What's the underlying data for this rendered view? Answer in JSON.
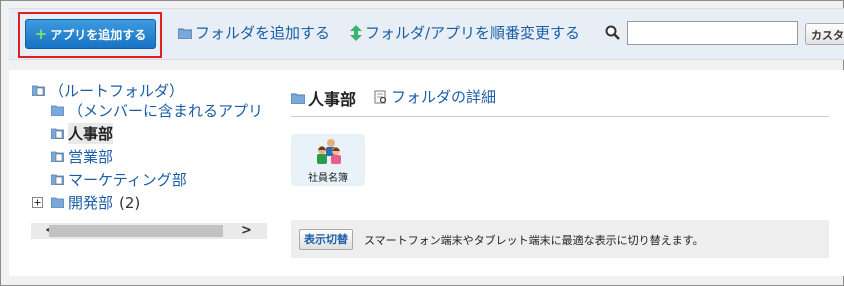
{
  "toolbar": {
    "add_app_label": "アプリを追加する",
    "add_folder_label": "フォルダを追加する",
    "reorder_label": "フォルダ/アプリを順番変更する",
    "search_value": "",
    "custom_button_label": "カスタ"
  },
  "tree": {
    "root": "（ルートフォルダ）",
    "member_apps": "（メンバーに含まれるアプリ",
    "items": [
      {
        "label": "人事部"
      },
      {
        "label": "営業部"
      },
      {
        "label": "マーケティング部"
      },
      {
        "label": "開発部",
        "count": "(2)"
      }
    ]
  },
  "folder": {
    "title": "人事部",
    "detail_link": "フォルダの詳細"
  },
  "apps": [
    {
      "label": "社員名簿",
      "icon": "people-icon"
    }
  ],
  "notice": {
    "button_label": "表示切替",
    "text": "スマートフォン端末やタブレット端末に最適な表示に切り替えます。"
  },
  "colors": {
    "link": "#1a5ea6",
    "primary_button": "#1873c2",
    "highlight": "#e02020",
    "toolbar_bg": "#e8eef6"
  }
}
